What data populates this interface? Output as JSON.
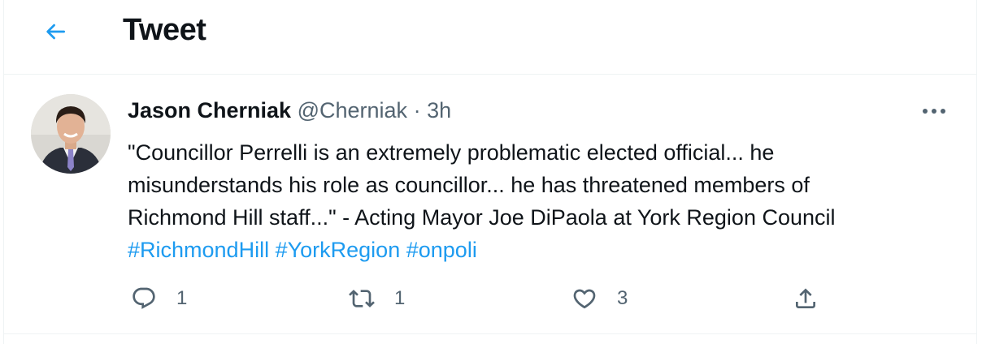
{
  "header": {
    "title": "Tweet",
    "back_icon": "arrow-left-icon"
  },
  "tweet": {
    "author_name": "Jason Cherniak",
    "handle": "@Cherniak",
    "separator": "·",
    "time": "3h",
    "text_line1": "\"Councillor Perrelli is an extremely problematic elected official... he",
    "text_line2": "misunderstands his role as councillor... he has threatened members of",
    "text_line3": "Richmond Hill staff...\" - Acting Mayor Joe DiPaola at York Region Council",
    "hashtags": [
      "#RichmondHill",
      "#YorkRegion",
      "#onpoli"
    ]
  },
  "actions": {
    "reply_count": "1",
    "retweet_count": "1",
    "like_count": "3"
  },
  "colors": {
    "accent": "#1d9bf0",
    "secondary_text": "#536471",
    "primary_text": "#0f1419"
  }
}
